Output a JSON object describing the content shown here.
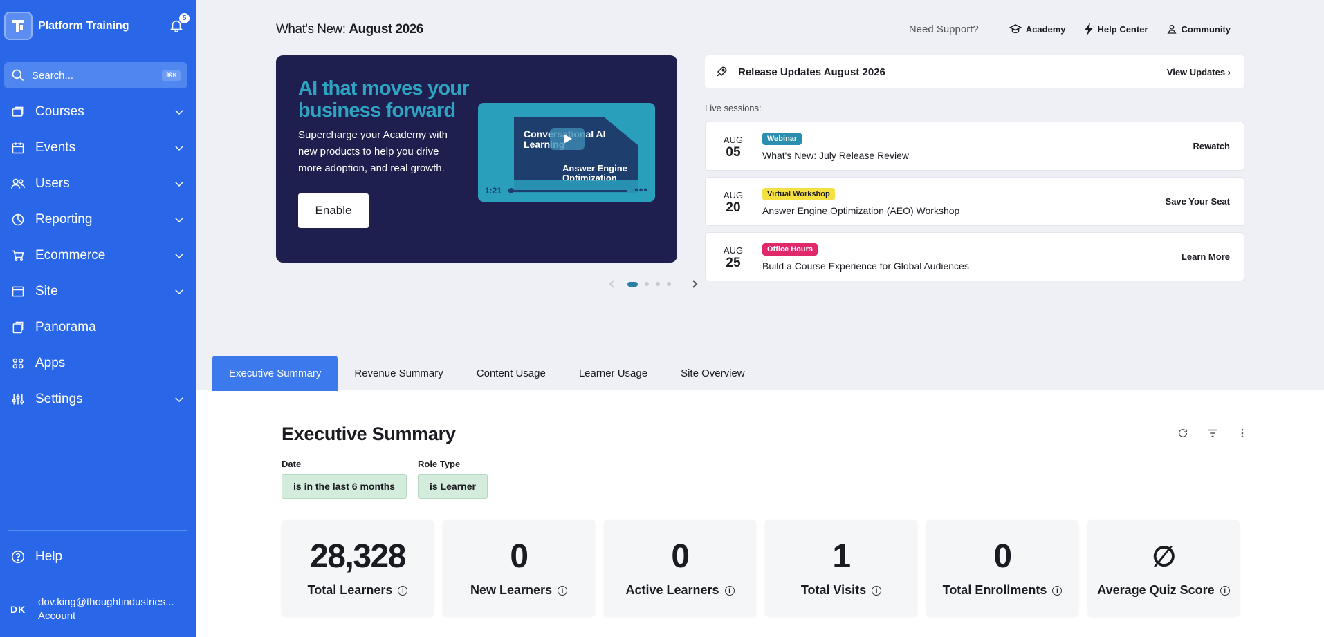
{
  "sidebar": {
    "brand": "Platform Training",
    "notifications_count": "5",
    "search_placeholder": "Search...",
    "search_shortcut": "⌘K",
    "items": [
      {
        "label": "Courses",
        "icon": "courses-icon",
        "expandable": true
      },
      {
        "label": "Events",
        "icon": "calendar-icon",
        "expandable": true
      },
      {
        "label": "Users",
        "icon": "users-icon",
        "expandable": true
      },
      {
        "label": "Reporting",
        "icon": "pie-chart-icon",
        "expandable": true
      },
      {
        "label": "Ecommerce",
        "icon": "cart-icon",
        "expandable": true
      },
      {
        "label": "Site",
        "icon": "browser-icon",
        "expandable": true
      },
      {
        "label": "Panorama",
        "icon": "panorama-icon",
        "expandable": false
      },
      {
        "label": "Apps",
        "icon": "apps-icon",
        "expandable": false
      },
      {
        "label": "Settings",
        "icon": "sliders-icon",
        "expandable": true
      }
    ],
    "help_label": "Help",
    "account_initials": "DK",
    "account_email": "dov.king@thoughtindustries...",
    "account_label": "Account"
  },
  "header": {
    "whats_new_prefix": "What's New:",
    "whats_new_month": "August 2026",
    "need_support": "Need Support?",
    "links": {
      "academy": "Academy",
      "help_center": "Help Center",
      "community": "Community"
    }
  },
  "hero": {
    "title": "AI that moves your business forward",
    "description": "Supercharge your Academy with new products to help you drive more adoption, and real growth.",
    "button": "Enable",
    "video_title_1": "Conversational AI Learning",
    "video_title_2": "Answer Engine Optimization",
    "video_time": "1:21"
  },
  "release": {
    "title": "Release Updates August 2026",
    "action": "View Updates ›"
  },
  "live_label": "Live sessions:",
  "sessions": [
    {
      "month": "AUG",
      "day": "05",
      "tag": "Webinar",
      "tag_color": "#2a8fae",
      "tag_text_color": "#ffffff",
      "title": "What's New: July Release Review",
      "action": "Rewatch"
    },
    {
      "month": "AUG",
      "day": "20",
      "tag": "Virtual Workshop",
      "tag_color": "#f5e042",
      "tag_text_color": "#1b1b22",
      "title": "Answer Engine Optimization (AEO) Workshop",
      "action": "Save Your Seat"
    },
    {
      "month": "AUG",
      "day": "25",
      "tag": "Office Hours",
      "tag_color": "#e0286b",
      "tag_text_color": "#ffffff",
      "title": "Build a Course Experience for Global Audiences",
      "action": "Learn More"
    }
  ],
  "tabs": [
    "Executive Summary",
    "Revenue Summary",
    "Content Usage",
    "Learner Usage",
    "Site Overview"
  ],
  "summary": {
    "title": "Executive Summary",
    "filters": [
      {
        "label": "Date",
        "value": "is in the last 6 months"
      },
      {
        "label": "Role Type",
        "value": "is Learner"
      }
    ],
    "metrics": [
      {
        "value": "28,328",
        "label": "Total Learners"
      },
      {
        "value": "0",
        "label": "New Learners"
      },
      {
        "value": "0",
        "label": "Active Learners"
      },
      {
        "value": "1",
        "label": "Total Visits"
      },
      {
        "value": "0",
        "label": "Total Enrollments"
      },
      {
        "value": "∅",
        "label": "Average Quiz Score"
      }
    ]
  }
}
